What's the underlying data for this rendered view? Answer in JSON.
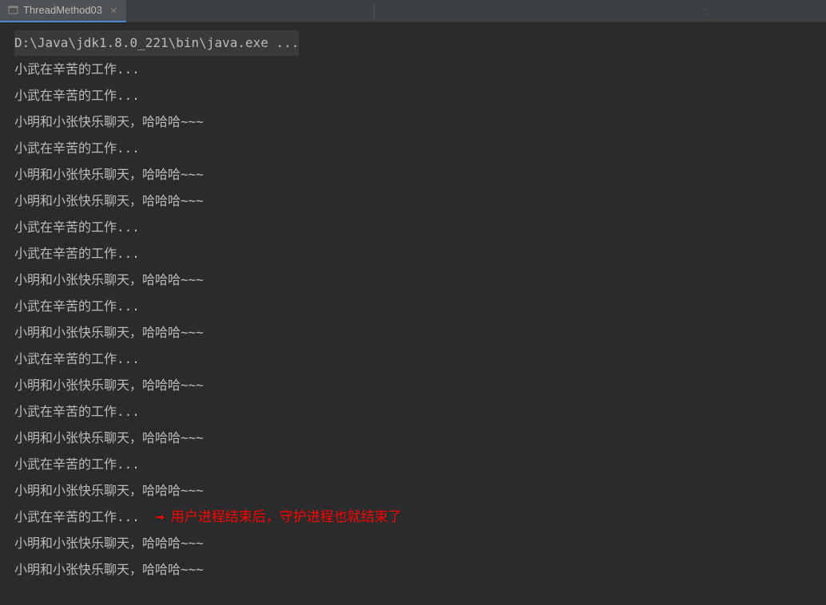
{
  "tab": {
    "label": "ThreadMethod03",
    "close": "×"
  },
  "tab_right": ":",
  "command": "D:\\Java\\jdk1.8.0_221\\bin\\java.exe ...",
  "lines": [
    "小武在辛苦的工作...",
    "小武在辛苦的工作...",
    "小明和小张快乐聊天，哈哈哈~~~",
    "小武在辛苦的工作...",
    "小明和小张快乐聊天，哈哈哈~~~",
    "小明和小张快乐聊天，哈哈哈~~~",
    "小武在辛苦的工作...",
    "小武在辛苦的工作...",
    "小明和小张快乐聊天，哈哈哈~~~",
    "小武在辛苦的工作...",
    "小明和小张快乐聊天，哈哈哈~~~",
    "小武在辛苦的工作...",
    "小明和小张快乐聊天，哈哈哈~~~",
    "小武在辛苦的工作...",
    "小明和小张快乐聊天，哈哈哈~~~",
    "小武在辛苦的工作...",
    "小明和小张快乐聊天，哈哈哈~~~",
    "小武在辛苦的工作...",
    "小明和小张快乐聊天，哈哈哈~~~",
    "小明和小张快乐聊天，哈哈哈~~~"
  ],
  "annotation": {
    "line_index": 17,
    "text": "用户进程结束后，守护进程也就结束了"
  }
}
